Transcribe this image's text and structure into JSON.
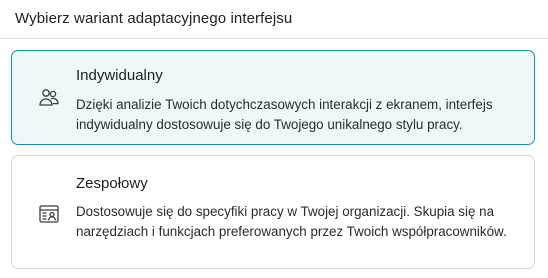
{
  "heading": "Wybierz wariant adaptacyjnego interfejsu",
  "options": [
    {
      "title": "Indywidualny",
      "description": "Dzięki analizie Twoich dotychczasowych interakcji z ekranem, interfejs indywidualny dostosowuje się do Twojego unikalnego stylu pracy.",
      "icon": "people-icon",
      "selected": true
    },
    {
      "title": "Zespołowy",
      "description": "Dostosowuje się do specyfiki pracy w Twojej organizacji. Skupia się na narzędziach i funkcjach preferowanych przez Twoich współpracowników.",
      "icon": "team-board-icon",
      "selected": false
    }
  ],
  "colors": {
    "selected_border": "#1c8fb3",
    "selected_background": "#eef8fb",
    "unselected_border": "#d9d9d9",
    "divider": "#e3e3e3",
    "icon_stroke": "#3c3c3c"
  }
}
